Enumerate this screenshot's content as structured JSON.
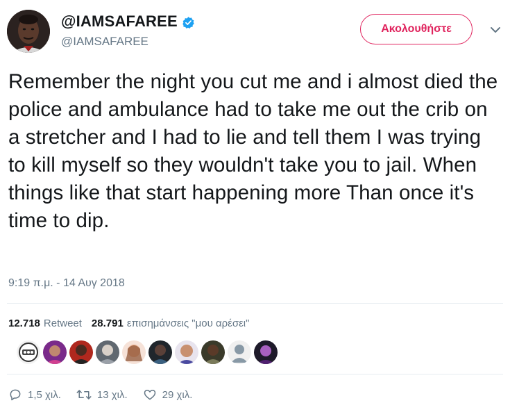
{
  "user": {
    "display_name": "@IAMSAFAREE",
    "handle": "@IAMSAFAREE"
  },
  "follow_button": {
    "label": "Ακολουθήστε"
  },
  "tweet": {
    "text": "Remember the night you cut me and i almost died the police and ambulance had to take me out the crib on a stretcher and I had to lie and tell them I was trying to kill myself so they wouldn't take you to jail. When things like that start happening more Than once it's time to dip.",
    "timestamp": "9:19 π.μ. - 14 Αυγ 2018"
  },
  "stats": {
    "retweets_count": "12.718",
    "retweets_label": "Retweet",
    "likes_count": "28.791",
    "likes_label": "επισημάνσεις \"μου αρέσει\""
  },
  "actions": {
    "replies": "1,5 χιλ.",
    "retweets": "13 χιλ.",
    "likes": "29 χιλ."
  },
  "colors": {
    "accent": "#e0245e",
    "verified": "#1da1f2",
    "muted": "#657786",
    "divider": "#e6ecf0"
  },
  "icons": {
    "verified": "verified-badge-icon",
    "caret": "chevron-down-icon",
    "reply": "reply-icon",
    "retweet": "retweet-icon",
    "like": "heart-icon"
  }
}
